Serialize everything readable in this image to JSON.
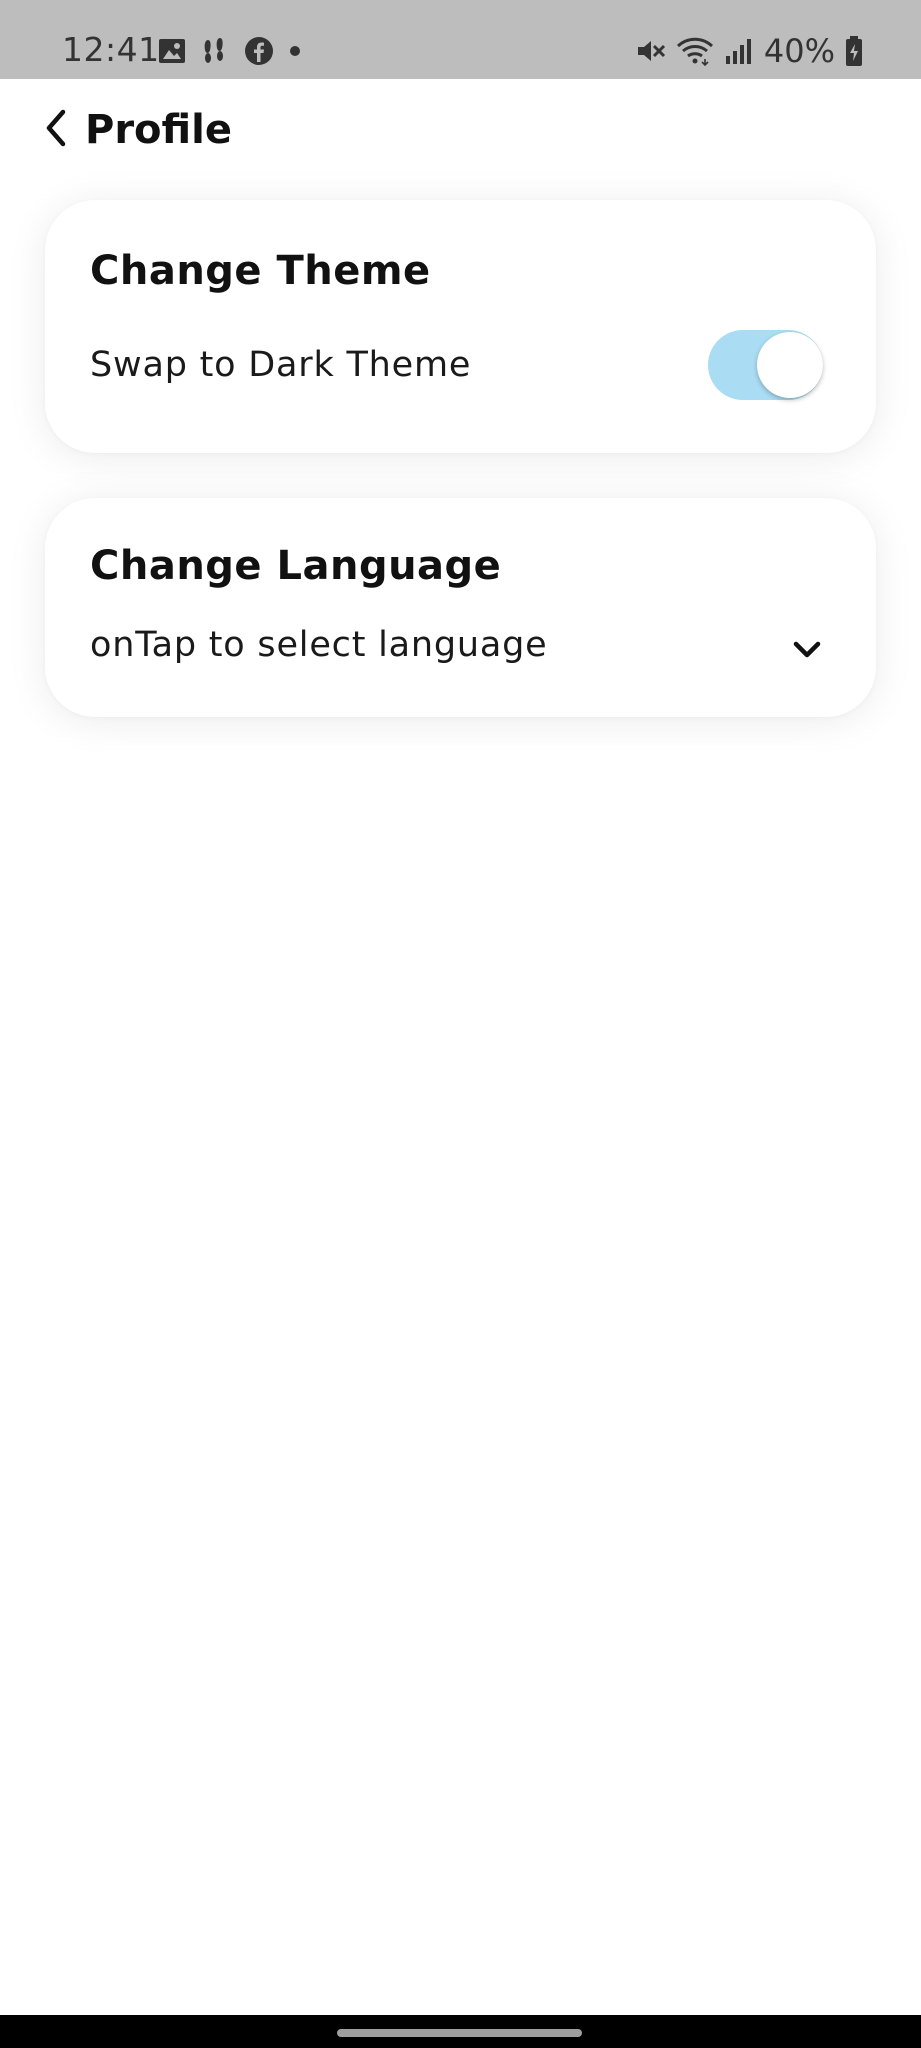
{
  "status_bar": {
    "time": "12:41",
    "battery_text": "40%",
    "icons_left": [
      "image-icon",
      "activity-icon",
      "facebook-icon",
      "dot-icon"
    ],
    "icons_right": [
      "vibrate-mute-icon",
      "wifi-icon",
      "signal-icon",
      "battery-icon"
    ]
  },
  "app_bar": {
    "title": "Profile",
    "back_icon": "chevron-left-icon"
  },
  "theme_card": {
    "title": "Change Theme",
    "label": "Swap to Dark Theme",
    "toggle_on": true,
    "toggle_color": "#aadcf3"
  },
  "language_card": {
    "title": "Change Language",
    "placeholder": "onTap to select language",
    "chevron_icon": "chevron-down-icon"
  }
}
